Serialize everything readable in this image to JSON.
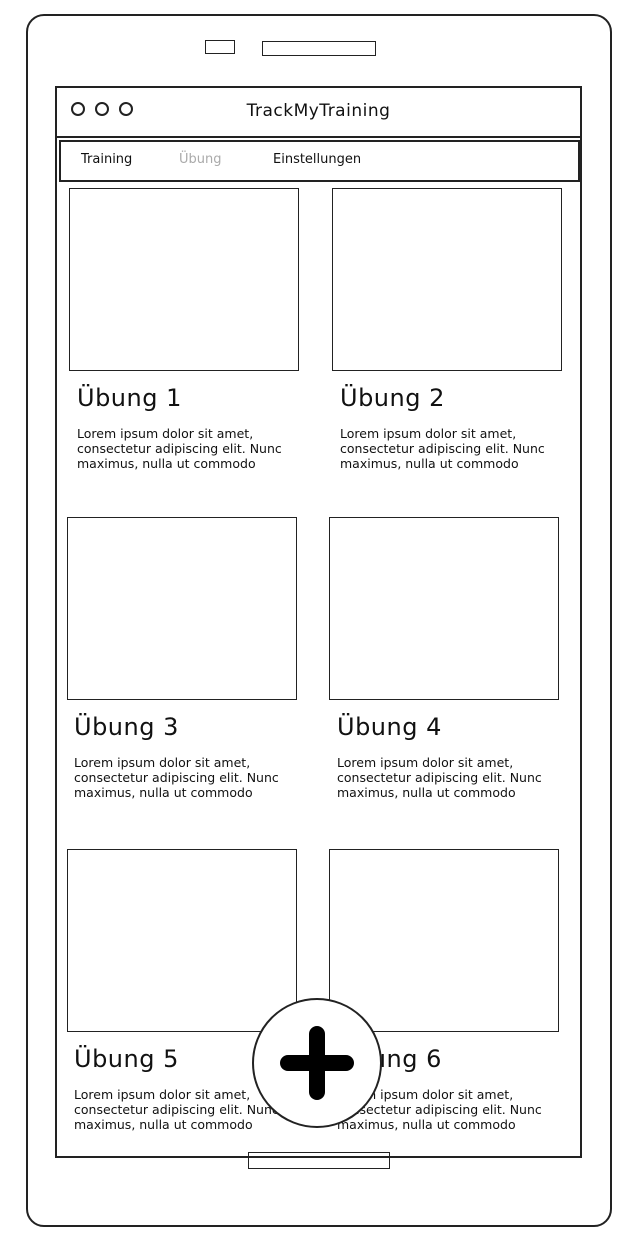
{
  "app": {
    "title": "TrackMyTraining"
  },
  "nav": [
    {
      "label": "Training",
      "active": true
    },
    {
      "label": "Übung",
      "active": false
    },
    {
      "label": "Einstellungen",
      "active": true
    }
  ],
  "cards": [
    {
      "title": "Übung 1",
      "description": "Lorem ipsum dolor sit amet, consectetur adipiscing elit. Nunc maximus, nulla ut commodo"
    },
    {
      "title": "Übung 2",
      "description": "Lorem ipsum dolor sit amet, consectetur adipiscing elit. Nunc maximus, nulla ut commodo"
    },
    {
      "title": "Übung 3",
      "description": "Lorem ipsum dolor sit amet, consectetur adipiscing elit. Nunc maximus, nulla ut commodo"
    },
    {
      "title": "Übung 4",
      "description": "Lorem ipsum dolor sit amet, consectetur adipiscing elit. Nunc maximus, nulla ut commodo"
    },
    {
      "title": "Übung 5",
      "description": "Lorem ipsum dolor sit amet, consectetur adipiscing elit. Nunc maximus, nulla ut commodo"
    },
    {
      "title": "Übung 6",
      "description": "Lorem ipsum dolor sit amet, consectetur adipiscing elit. Nunc maximus, nulla ut commodo"
    }
  ],
  "fab": {
    "icon": "plus-icon"
  },
  "colors": {
    "ink": "#222222",
    "dim": "#aaaaaa",
    "background": "#ffffff"
  }
}
